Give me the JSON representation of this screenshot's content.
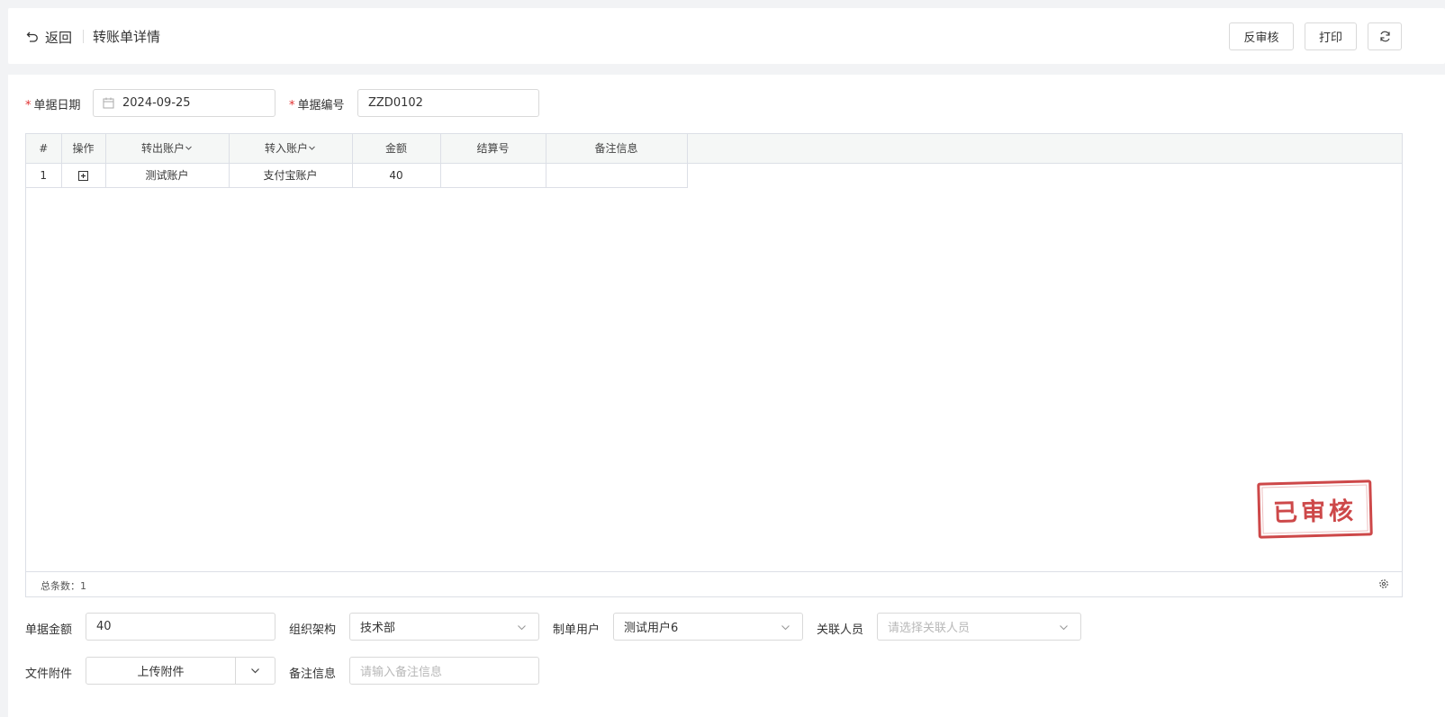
{
  "header": {
    "back_label": "返回",
    "title": "转账单详情",
    "unapprove_label": "反审核",
    "print_label": "打印"
  },
  "form": {
    "date_label": "单据日期",
    "date_value": "2024-09-25",
    "number_label": "单据编号",
    "number_value": "ZZD0102"
  },
  "table": {
    "columns": [
      "#",
      "操作",
      "转出账户",
      "转入账户",
      "金额",
      "结算号",
      "备注信息"
    ],
    "rows": [
      {
        "index": "1",
        "from_account": "测试账户",
        "to_account": "支付宝账户",
        "amount": "40",
        "settlement_no": "",
        "remark": ""
      }
    ],
    "total_label": "总条数：1"
  },
  "stamp": "已审核",
  "bottom": {
    "amount_label": "单据金额",
    "amount_value": "40",
    "org_label": "组织架构",
    "org_value": "技术部",
    "creator_label": "制单用户",
    "creator_value": "测试用户6",
    "related_label": "关联人员",
    "related_placeholder": "请选择关联人员",
    "attachment_label": "文件附件",
    "upload_label": "上传附件",
    "remark_label": "备注信息",
    "remark_placeholder": "请输入备注信息"
  },
  "icons": [
    "undo-icon",
    "calendar-icon",
    "plus-square-icon",
    "chevron-down-icon",
    "refresh-icon",
    "gear-icon"
  ],
  "colors": {
    "stamp": "#c9393a",
    "required": "#e03030",
    "border": "#d9d9d9"
  }
}
